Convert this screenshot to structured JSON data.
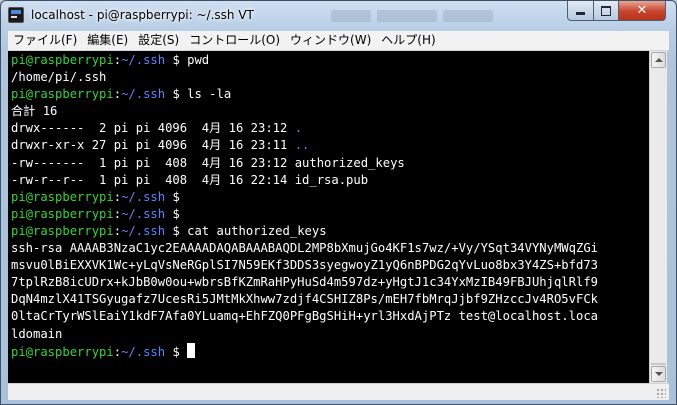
{
  "window": {
    "title": "localhost - pi@raspberrypi: ~/.ssh VT"
  },
  "controls": {
    "minimize_icon": "minimize-icon",
    "maximize_icon": "maximize-icon",
    "close_label": "✕"
  },
  "menu": [
    {
      "label": "ファイル(F)"
    },
    {
      "label": "編集(E)"
    },
    {
      "label": "設定(S)"
    },
    {
      "label": "コントロール(O)"
    },
    {
      "label": "ウィンドウ(W)"
    },
    {
      "label": "ヘルプ(H)"
    }
  ],
  "terminal": {
    "colors": {
      "prompt_user": "#3cd13c",
      "prompt_path": "#5a86ff",
      "text": "#ffffff",
      "background": "#000000"
    },
    "prompt": {
      "user": "pi@raspberrypi",
      "sep": ":",
      "path": "~/.ssh",
      "symbol": " $"
    },
    "lines": [
      {
        "kind": "prompt",
        "cmd": " pwd"
      },
      {
        "kind": "out",
        "text": "/home/pi/.ssh"
      },
      {
        "kind": "prompt",
        "cmd": " ls -la"
      },
      {
        "kind": "out",
        "text": "合計 16"
      },
      {
        "kind": "ls",
        "text": "drwx------  2 pi pi 4096  4月 16 23:12 ",
        "name": ".",
        "dir": true
      },
      {
        "kind": "ls",
        "text": "drwxr-xr-x 27 pi pi 4096  4月 16 23:11 ",
        "name": "..",
        "dir": true
      },
      {
        "kind": "ls",
        "text": "-rw-------  1 pi pi  408  4月 16 23:12 ",
        "name": "authorized_keys",
        "dir": false
      },
      {
        "kind": "ls",
        "text": "-rw-r--r--  1 pi pi  408  4月 16 22:14 ",
        "name": "id_rsa.pub",
        "dir": false
      },
      {
        "kind": "prompt",
        "cmd": ""
      },
      {
        "kind": "prompt",
        "cmd": ""
      },
      {
        "kind": "prompt",
        "cmd": " cat authorized_keys"
      },
      {
        "kind": "out",
        "text": "ssh-rsa AAAAB3NzaC1yc2EAAAADAQABAAABAQDL2MP8bXmujGo4KF1s7wz/+Vy/YSqt34VYNyMWqZGi"
      },
      {
        "kind": "out",
        "text": "msvu0lBiEXXVK1Wc+yLqVsNeRGplSI7N59EKf3DDS3syegwoyZ1yQ6nBPDG2qYvLuo8bx3Y4ZS+bfd73"
      },
      {
        "kind": "out",
        "text": "7tplRzB8icUDrx+kJbB0w0ou+wbrsBfKZmRaHPyHuSd4m597dz+yHgtJ1c34YxMzIB49FBJUhjqlRlf9"
      },
      {
        "kind": "out",
        "text": "DqN4mzlX41TSGyugafz7UcesRi5JMtMkXhww7zdjf4CSHIZ8Ps/mEH7fbMrqJjbf9ZHzccJv4RO5vFCk"
      },
      {
        "kind": "out",
        "text": "0ltaCrTyrWSlEaiY1kdF7Afa0YLuamq+EhFZQ0PFgBgSHiH+yrl3HxdAjPTz test@localhost.loca"
      },
      {
        "kind": "out",
        "text": "ldomain"
      },
      {
        "kind": "prompt",
        "cmd": " ",
        "cursor": true
      }
    ]
  }
}
